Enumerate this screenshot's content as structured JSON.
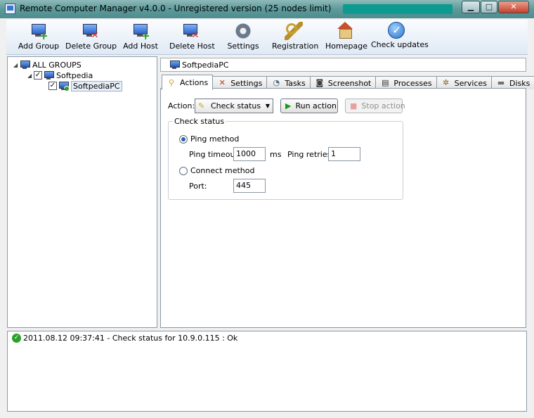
{
  "window": {
    "title": "Remote Computer Manager v4.0.0 - Unregistered version (25 nodes limit)"
  },
  "toolbar": {
    "add_group": "Add Group",
    "delete_group": "Delete Group",
    "add_host": "Add Host",
    "delete_host": "Delete Host",
    "settings": "Settings",
    "registration": "Registration",
    "homepage": "Homepage",
    "check_updates": "Check updates"
  },
  "tree": {
    "root": "ALL GROUPS",
    "group": "Softpedia",
    "host": "SoftpediaPC"
  },
  "host_header": "SoftpediaPC",
  "tabs": [
    {
      "label": "Actions",
      "icon": "wrench-icon"
    },
    {
      "label": "Settings",
      "icon": "tools-icon"
    },
    {
      "label": "Tasks",
      "icon": "stopwatch-icon"
    },
    {
      "label": "Screenshot",
      "icon": "camera-icon"
    },
    {
      "label": "Processes",
      "icon": "terminal-icon"
    },
    {
      "label": "Services",
      "icon": "gears-icon"
    },
    {
      "label": "Disks",
      "icon": "disk-icon"
    }
  ],
  "actions": {
    "action_label": "Action:",
    "selected_action": "Check status",
    "run_button": "Run action",
    "stop_button": "Stop action",
    "group_title": "Check status",
    "ping_method": "Ping method",
    "ping_timeout_label": "Ping timeout:",
    "ping_timeout": "1000",
    "ms": "ms",
    "ping_retries_label": "Ping retries:",
    "ping_retries": "1",
    "connect_method": "Connect method",
    "port_label": "Port:",
    "port": "445"
  },
  "log": {
    "entry": "2011.08.12 09:37:41 - Check status for 10.9.0.115 : Ok"
  }
}
